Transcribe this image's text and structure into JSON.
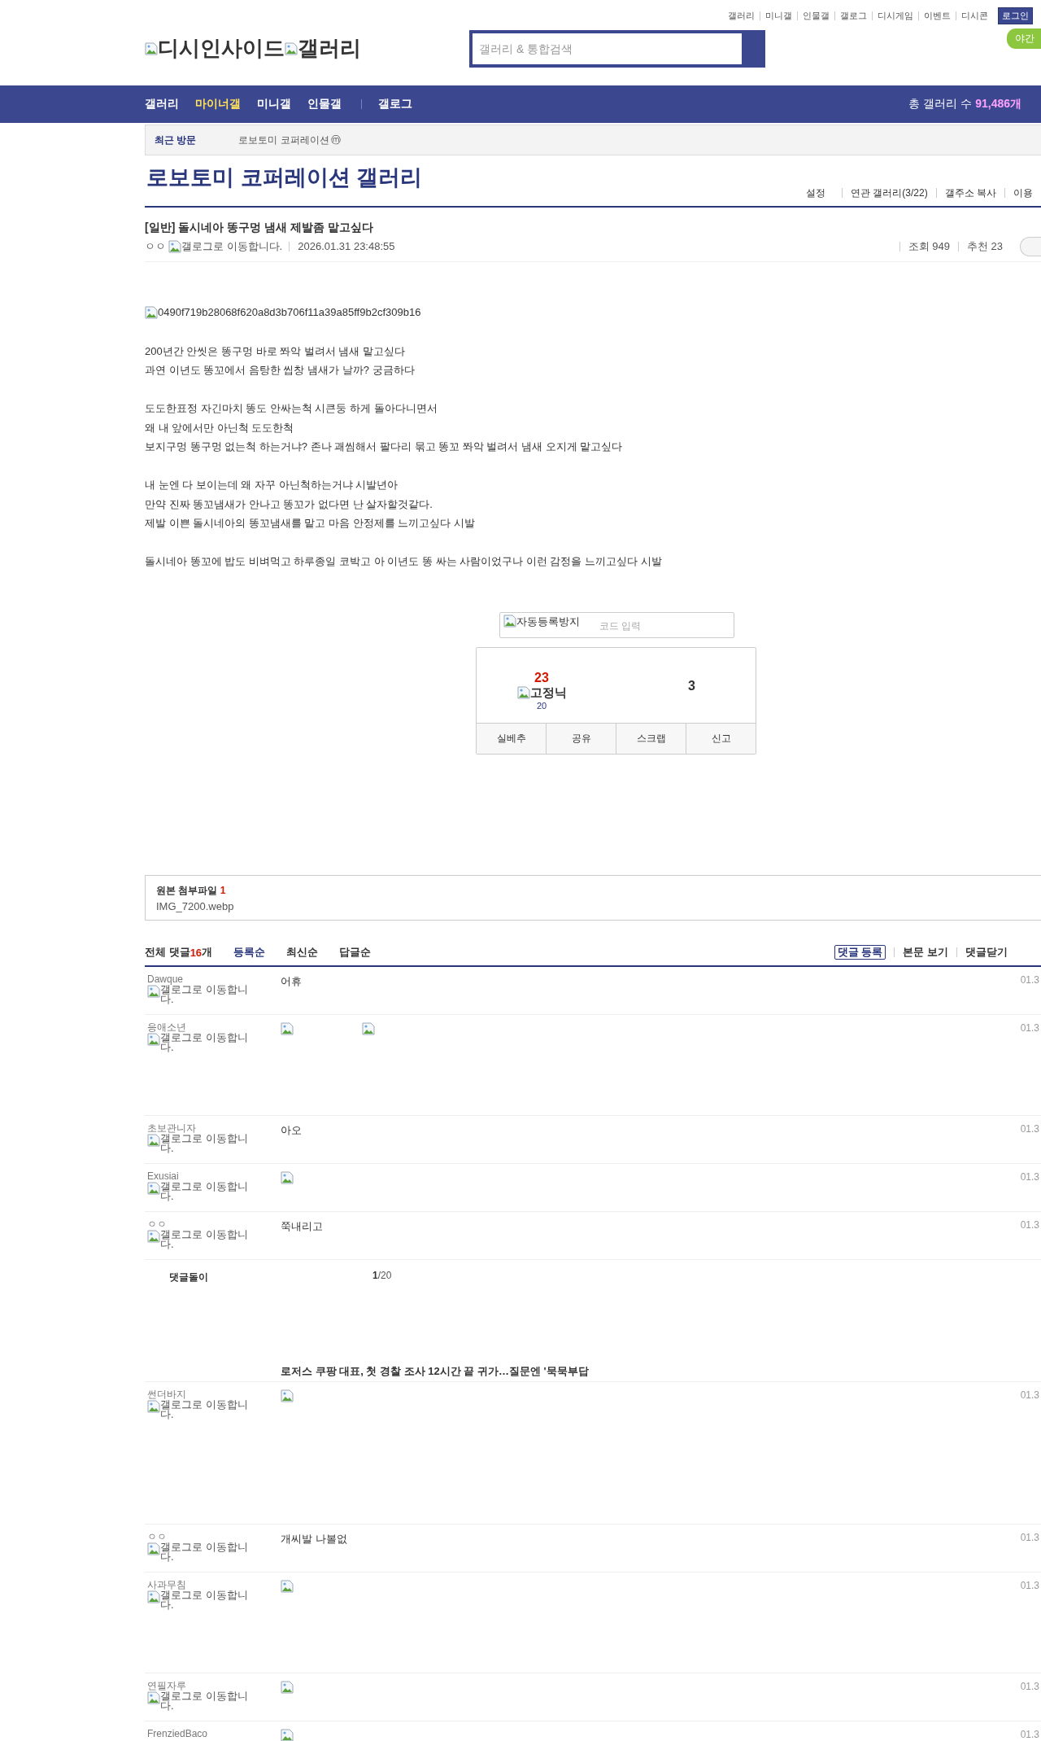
{
  "top_links": [
    "갤러리",
    "미니갤",
    "인물갤",
    "갤로그",
    "디시게임",
    "이벤트",
    "디시콘"
  ],
  "login_button": "로그인",
  "night_mode_button": "야간",
  "logo": {
    "site_alt": "디시인사이드",
    "section_alt": "갤러리"
  },
  "search": {
    "placeholder": "갤러리 & 통합검색"
  },
  "nav": {
    "items": [
      {
        "label": "갤러리",
        "selected": false,
        "divider_before": false
      },
      {
        "label": "마이너갤",
        "selected": true,
        "divider_before": false
      },
      {
        "label": "미니갤",
        "selected": false,
        "divider_before": false
      },
      {
        "label": "인물갤",
        "selected": false,
        "divider_before": false
      },
      {
        "label": "갤로그",
        "selected": false,
        "divider_before": true
      }
    ],
    "total_label": "총 갤러리 수",
    "total": "91,486개"
  },
  "recent": {
    "label": "최근 방문",
    "items": [
      {
        "name": "로보토미 코퍼레이션",
        "badge": "ⓜ"
      }
    ]
  },
  "gallery": {
    "title": "로보토미 코퍼레이션 갤러리",
    "tools": [
      "설정",
      "연관 갤러리(3/22)",
      "갤주소 복사",
      "이용"
    ]
  },
  "post": {
    "title": "[일반] 돌시네아 똥구멍 냄새 제발좀 맡고싶다",
    "author": "ㅇㅇ",
    "gallog_alt": "갤로그로 이동합니다.",
    "date": "2026.01.31 23:48:55",
    "views": "조회 949",
    "recommends": "추천 23",
    "image_alt": "0490f719b28068f620a8d3b706f11a39a85ff9b2cf309b16",
    "paragraphs": [
      [
        "200년간 안씻은 똥구멍 바로 쫘악 벌려서 냄새 맡고싶다",
        "과연 이년도 똥꼬에서 음탕한 씹창 냄새가 날까? 궁금하다"
      ],
      [
        "도도한표정 자긴마치 똥도 안싸는척 시큰둥 하게 돌아다니면서",
        "왜 내 앞에서만 아닌척 도도한척",
        "보지구멍 똥구멍 없는척 하는거냐? 존나 괘씸해서 팔다리 묶고 똥꼬 쫘악 벌려서 냄새 오지게 맡고싶다"
      ],
      [
        "내 눈엔 다 보이는데 왜 자꾸 아닌척하는거냐 시발년아",
        "만약 진짜 똥꼬냄새가 안나고 똥꼬가 없다면 난 살자할것같다.",
        "제발 이쁜 돌시네아의  똥꼬냄새를 맡고 마음 안정제를 느끼고싶다 시발"
      ],
      [
        "돌시네아 똥꼬에 밥도 비벼먹고 하루종일 코박고 아 이년도 똥 싸는 사람이었구나 이런 감정을 느끼고싶다 시발"
      ]
    ]
  },
  "captcha": {
    "image_alt": "자동등록방지",
    "placeholder": "코드 입력"
  },
  "recommend": {
    "up_count": "23",
    "fixed_alt": "고정닉",
    "fixed_count": "20",
    "down_count": "3",
    "buttons": [
      "실베추",
      "공유",
      "스크랩",
      "신고"
    ]
  },
  "attachments": {
    "label": "원본 첨부파일",
    "count": "1",
    "files": [
      "IMG_7200.webp"
    ]
  },
  "comments": {
    "total_label": "전체 댓글",
    "count": "16",
    "unit": "개",
    "sorts": [
      {
        "label": "등록순",
        "selected": true
      },
      {
        "label": "최신순",
        "selected": false
      },
      {
        "label": "답글순",
        "selected": false
      }
    ],
    "actions": [
      {
        "label": "댓글 등록",
        "kind": "outlined"
      },
      {
        "label": "본문 보기",
        "kind": "plain"
      },
      {
        "label": "댓글닫기",
        "kind": "plain"
      }
    ],
    "items": [
      {
        "kind": "text",
        "nick": "Dawque",
        "gallog_alt": "갤로그로 이동합니다.",
        "text": "어휴",
        "date": "01.3"
      },
      {
        "kind": "dccon",
        "nick": "응애소년",
        "gallog_alt": "갤로그로 이동합니다.",
        "date": "01.3"
      },
      {
        "kind": "text",
        "nick": "초보관니자",
        "gallog_alt": "갤로그로 이동합니다.",
        "text": "아오",
        "date": "01.3"
      },
      {
        "kind": "image",
        "nick": "Exusiai",
        "gallog_alt": "갤로그로 이동합니다.",
        "date": "01.3"
      },
      {
        "kind": "text",
        "nick": "ㅇㅇ",
        "gallog_alt": "갤로그로 이동합니다.",
        "text": "쭉내리고",
        "date": "01.3"
      },
      {
        "kind": "bot",
        "nick": "댓글돌이",
        "page": "1",
        "pages": "/20",
        "headline": "로저스 쿠팡 대표, 첫 경찰 조사 12시간 끝 귀가…질문엔 '묵묵부답"
      },
      {
        "kind": "dccon",
        "nick": "썬더바지",
        "gallog_alt": "갤로그로 이동합니다.",
        "date": "01.3"
      },
      {
        "kind": "text",
        "nick": "ㅇㅇ",
        "gallog_alt": "갤로그로 이동합니다.",
        "text": "개씨발 나볼없",
        "date": "01.3"
      },
      {
        "kind": "dccon",
        "nick": "사과무침",
        "gallog_alt": "갤로그로 이동합니다.",
        "date": "01.3"
      },
      {
        "kind": "image",
        "nick": "연필자루",
        "gallog_alt": "갤로그로 이동합니다.",
        "date": "01.3"
      },
      {
        "kind": "image",
        "nick": "FrenziedBaco",
        "date": "01.3"
      }
    ]
  }
}
